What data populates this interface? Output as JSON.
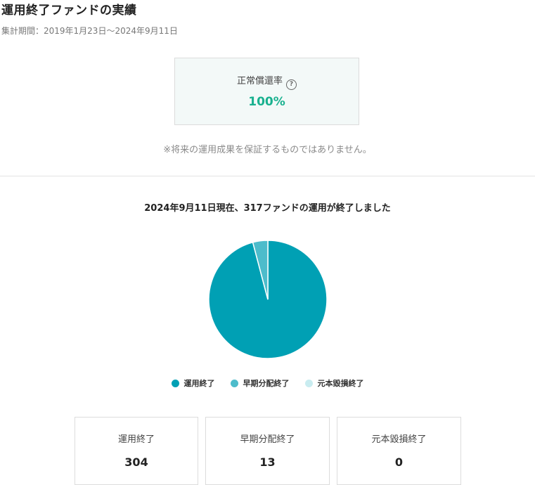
{
  "header": {
    "title": "運用終了ファンドの実績",
    "period": "集計期間：2019年1月23日〜2024年9月11日"
  },
  "rate": {
    "label": "正常償還率",
    "help_icon": "?",
    "value": "100%"
  },
  "disclaimer": "※将来の運用成果を保証するものではありません。",
  "chart_heading": "2024年9月11日現在、317ファンドの運用が終了しました",
  "chart_data": {
    "type": "pie",
    "categories": [
      "運用終了",
      "早期分配終了",
      "元本毀損終了"
    ],
    "values": [
      304,
      13,
      0
    ],
    "colors": [
      "#00a0b4",
      "#4dbccb",
      "#c9ecf0"
    ],
    "legend_position": "bottom"
  },
  "cards": [
    {
      "label": "運用終了",
      "value": "304"
    },
    {
      "label": "早期分配終了",
      "value": "13"
    },
    {
      "label": "元本毀損終了",
      "value": "0"
    }
  ]
}
